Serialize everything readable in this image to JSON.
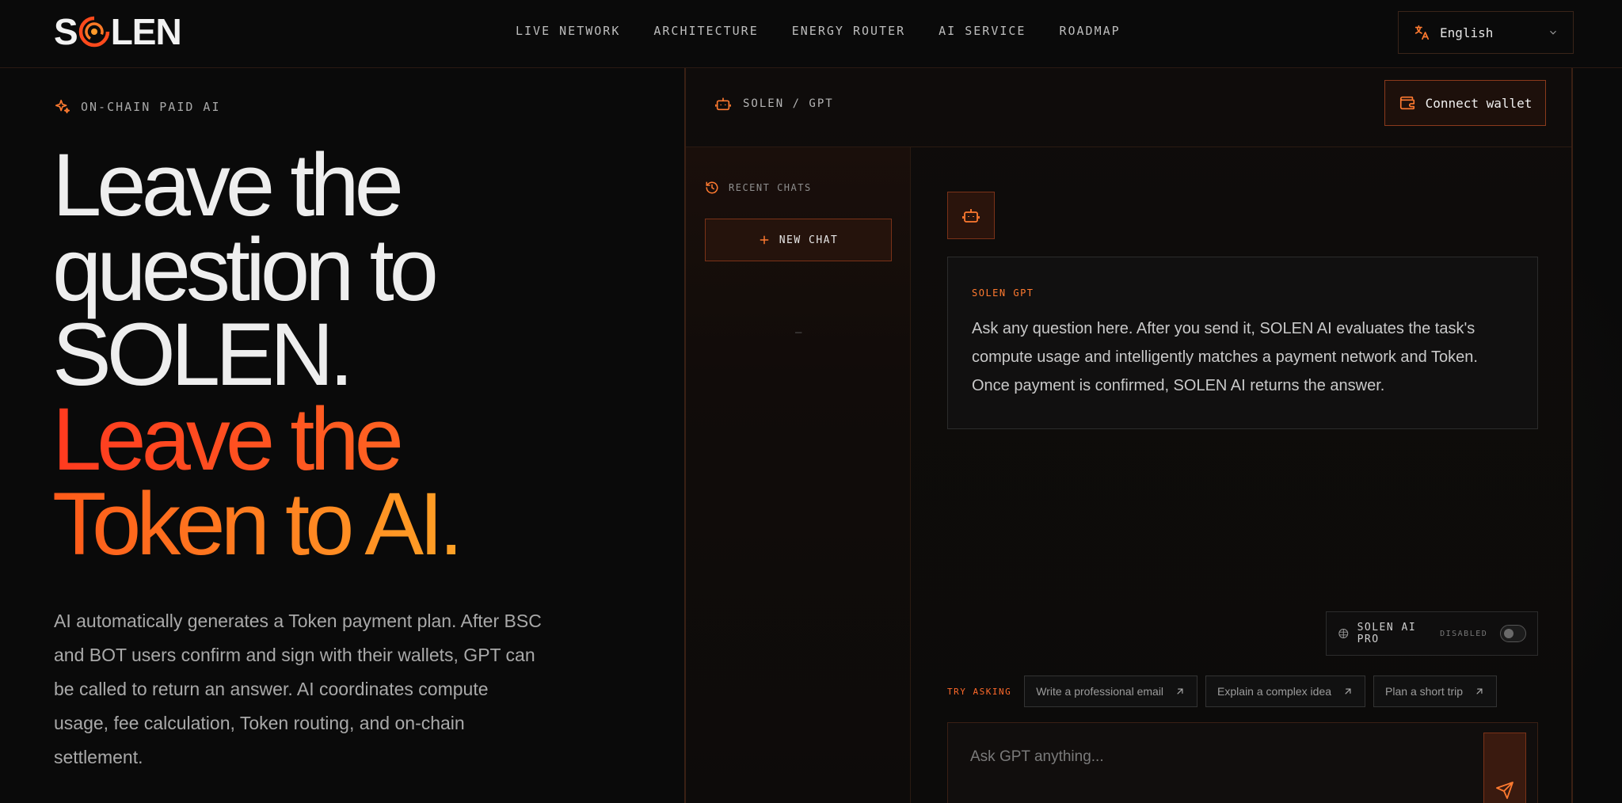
{
  "nav": {
    "logo_text": "SOLEN",
    "links": [
      "LIVE NETWORK",
      "ARCHITECTURE",
      "ENERGY ROUTER",
      "AI SERVICE",
      "ROADMAP"
    ],
    "language": "English"
  },
  "hero": {
    "badge": "ON-CHAIN PAID AI",
    "headline_white": [
      "Leave the",
      "question to",
      "SOLEN."
    ],
    "headline_orange": [
      "Leave the",
      "Token to AI."
    ],
    "description": "AI automatically generates a Token payment plan. After BSC and BOT users confirm and sign with their wallets, GPT can be called to return an answer. AI coordinates compute usage, fee calculation, Token routing, and on-chain settlement."
  },
  "panel": {
    "title": "SOLEN / GPT",
    "connect_wallet": "Connect wallet",
    "sidebar": {
      "recent_label": "RECENT CHATS",
      "new_chat": "NEW CHAT",
      "empty": "—"
    },
    "message": {
      "from": "SOLEN GPT",
      "body": "Ask any question here. After you send it, SOLEN AI evaluates the task's compute usage and intelligently matches a payment network and Token. Once payment is confirmed, SOLEN AI returns the answer."
    },
    "pro": {
      "label": "SOLEN AI PRO",
      "status": "DISABLED",
      "enabled": false
    },
    "try_asking": {
      "label": "TRY ASKING",
      "chips": [
        "Write a professional email",
        "Explain a complex idea",
        "Plan a short trip"
      ]
    },
    "composer": {
      "placeholder": "Ask GPT anything..."
    }
  },
  "colors": {
    "accent_orange": "#ff6a22",
    "accent_red": "#ff3a1f",
    "accent_amber": "#ffa126",
    "background": "#0a0a0a",
    "border_brown": "#3a2014"
  },
  "icons": {
    "logo_ring": "solen-ring-icon",
    "language": "translate-icon",
    "dropdown": "chevron-down-icon",
    "badge": "sparkle-icon",
    "panel_title": "robot-icon",
    "wallet": "wallet-icon",
    "recent": "history-icon",
    "new_chat": "plus-icon",
    "bot": "robot-icon",
    "pro": "cube-icon",
    "chip": "arrow-up-right-icon",
    "send": "send-icon"
  }
}
